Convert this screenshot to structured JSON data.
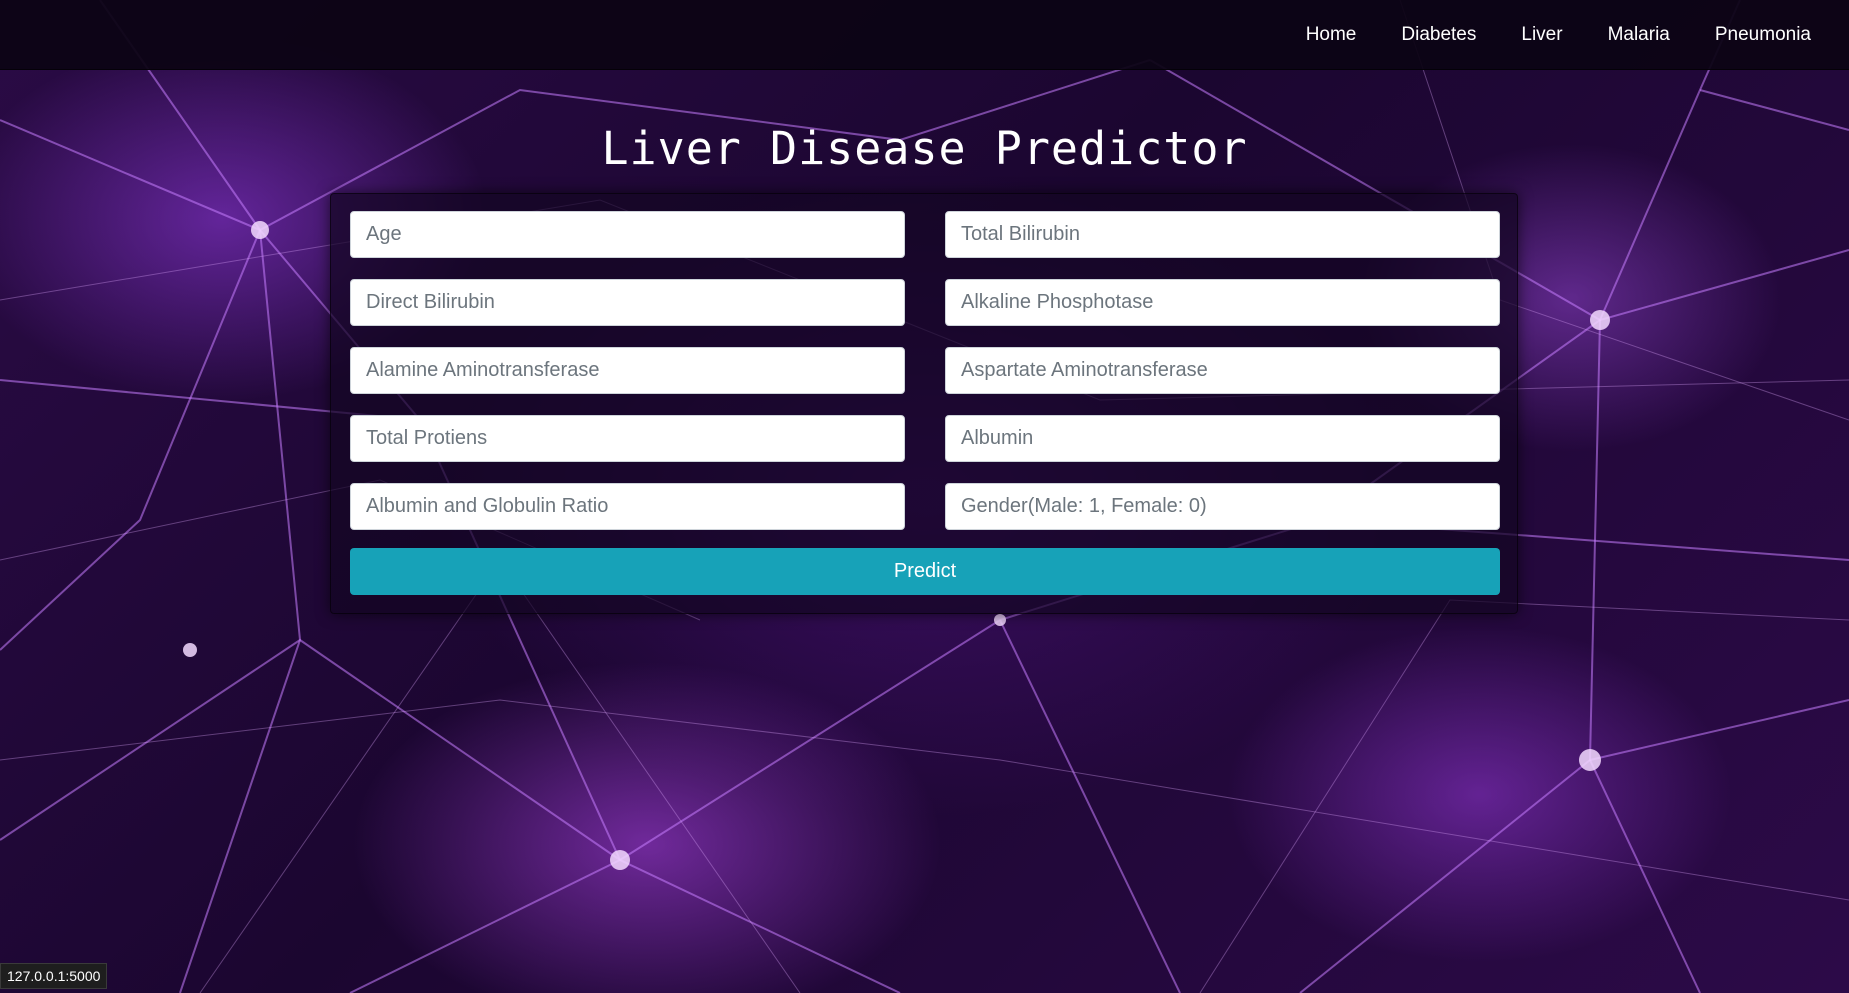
{
  "nav": {
    "items": [
      {
        "label": "Home"
      },
      {
        "label": "Diabetes"
      },
      {
        "label": "Liver"
      },
      {
        "label": "Malaria"
      },
      {
        "label": "Pneumonia"
      }
    ]
  },
  "page": {
    "title": "Liver Disease Predictor"
  },
  "form": {
    "fields": [
      {
        "placeholder": "Age",
        "value": ""
      },
      {
        "placeholder": "Total Bilirubin",
        "value": ""
      },
      {
        "placeholder": "Direct Bilirubin",
        "value": ""
      },
      {
        "placeholder": "Alkaline Phosphotase",
        "value": ""
      },
      {
        "placeholder": "Alamine Aminotransferase",
        "value": ""
      },
      {
        "placeholder": "Aspartate Aminotransferase",
        "value": ""
      },
      {
        "placeholder": "Total Protiens",
        "value": ""
      },
      {
        "placeholder": "Albumin",
        "value": ""
      },
      {
        "placeholder": "Albumin and Globulin Ratio",
        "value": ""
      },
      {
        "placeholder": "Gender(Male: 1, Female: 0)",
        "value": ""
      }
    ],
    "submit_label": "Predict"
  },
  "status_bar": {
    "url": "127.0.0.1:5000"
  },
  "colors": {
    "button": "#17a2b8",
    "navbar": "#0c0414",
    "background": "#1b0630"
  }
}
